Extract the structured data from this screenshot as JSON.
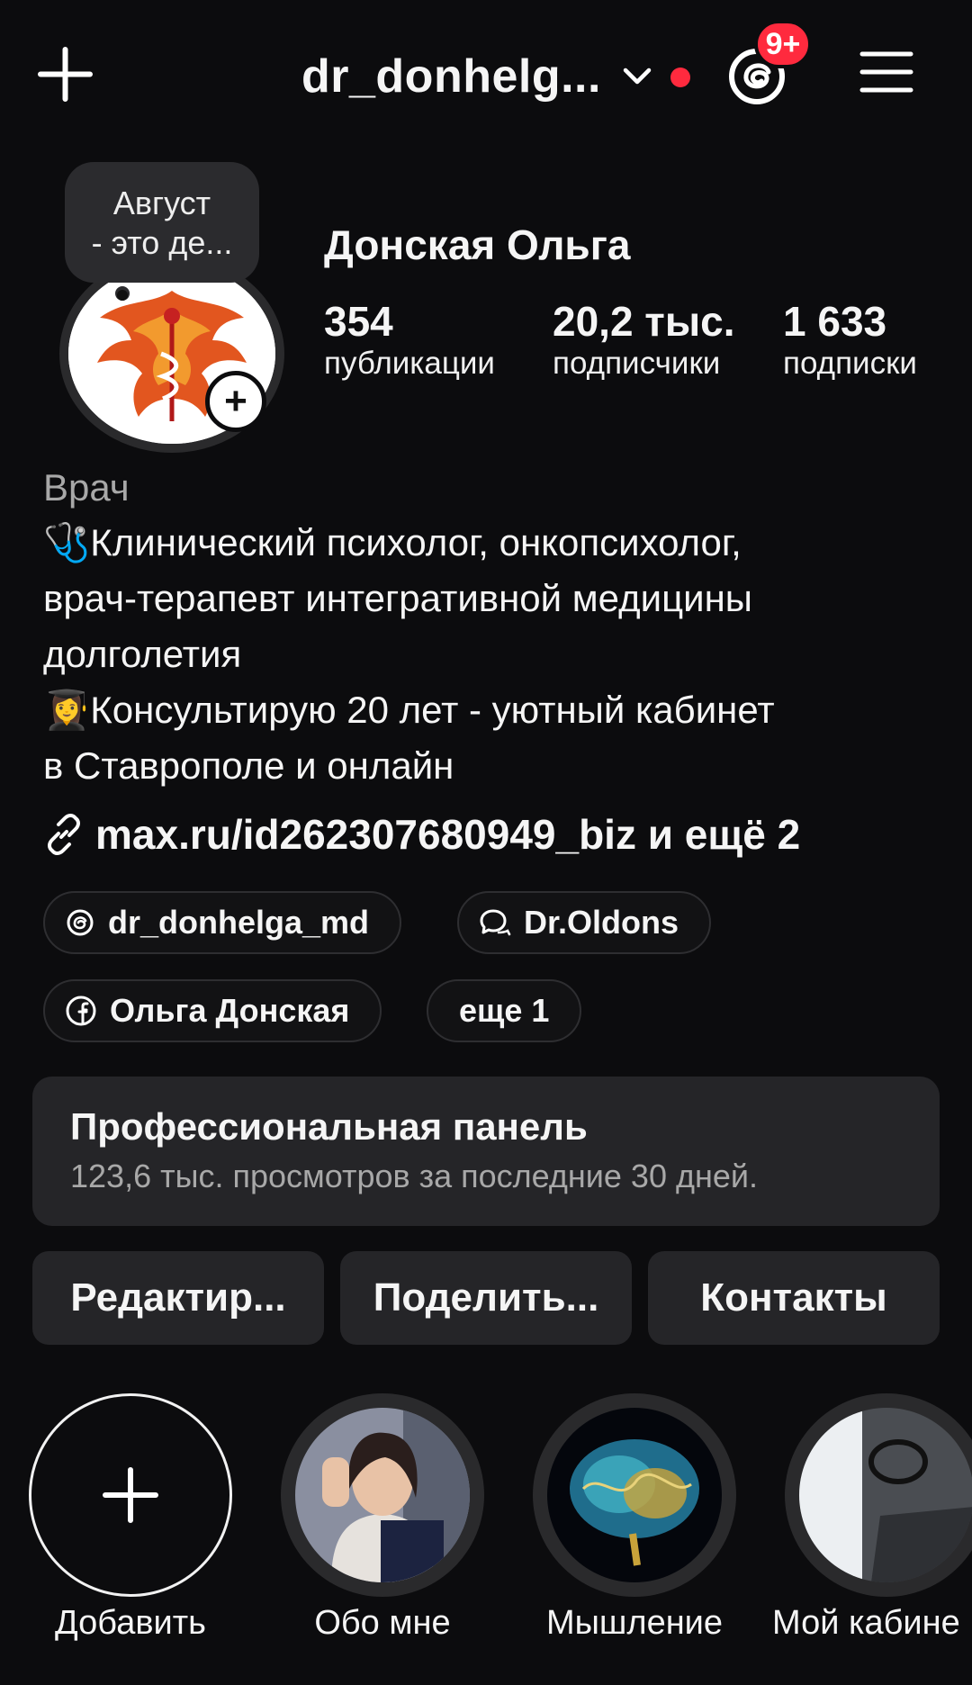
{
  "topbar": {
    "username": "dr_donhelg...",
    "notification_count": "9+",
    "icons": [
      "plus-icon",
      "chevron-down-icon",
      "threads-icon",
      "menu-icon"
    ],
    "unread_dot_color": "#ff2a3e"
  },
  "profile": {
    "note": "Август\n- это де...",
    "name": "Донская Ольга",
    "stats": [
      {
        "value": "354",
        "label": "публикации"
      },
      {
        "value": "20,2 тыс.",
        "label": "подписчики"
      },
      {
        "value": "1 633",
        "label": "подписки"
      }
    ],
    "category": "Врач",
    "bio_lines": [
      "🩺Клинический психолог, онкопсихолог,",
      "врач-терапевт интегративной медицины",
      "долголетия",
      "👩‍🎓Консультирую 20 лет - уютный кабинет",
      "в Ставрополе и онлайн"
    ],
    "link": "max.ru/id262307680949_biz и ещё 2"
  },
  "chips": [
    {
      "label": "dr_donhelga_md",
      "icon": "threads-icon"
    },
    {
      "label": "Dr.Oldons",
      "icon": "chat-bubble-icon"
    },
    {
      "label": "Ольга Донская",
      "icon": "facebook-icon"
    },
    {
      "label": "еще 1",
      "icon": ""
    }
  ],
  "pro_panel": {
    "title": "Профессиональная панель",
    "subtitle": "123,6 тыс. просмотров за последние 30 дней."
  },
  "buttons": [
    "Редактир...",
    "Поделить...",
    "Контакты"
  ],
  "highlights": [
    {
      "label": "Добавить"
    },
    {
      "label": "Обо мне"
    },
    {
      "label": "Мышление"
    },
    {
      "label": "Мой кабине"
    }
  ]
}
